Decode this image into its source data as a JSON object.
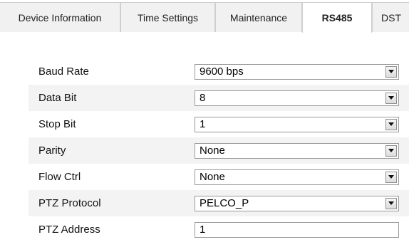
{
  "tabs": [
    {
      "label": "Device Information"
    },
    {
      "label": "Time Settings"
    },
    {
      "label": "Maintenance"
    },
    {
      "label": "RS485"
    },
    {
      "label": "DST"
    }
  ],
  "active_tab": "RS485",
  "form": {
    "baud_rate": {
      "label": "Baud Rate",
      "value": "9600 bps"
    },
    "data_bit": {
      "label": "Data Bit",
      "value": "8"
    },
    "stop_bit": {
      "label": "Stop Bit",
      "value": "1"
    },
    "parity": {
      "label": "Parity",
      "value": "None"
    },
    "flow_ctrl": {
      "label": "Flow Ctrl",
      "value": "None"
    },
    "ptz_protocol": {
      "label": "PTZ Protocol",
      "value": "PELCO_P"
    },
    "ptz_address": {
      "label": "PTZ Address",
      "value": "1"
    }
  }
}
